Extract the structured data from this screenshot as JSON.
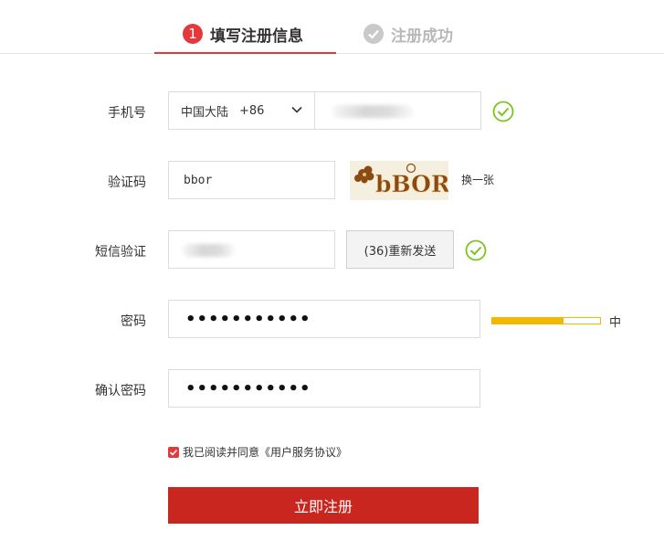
{
  "steps": {
    "step1_number": "1",
    "step1_label": "填写注册信息",
    "step2_label": "注册成功"
  },
  "form": {
    "phone": {
      "label": "手机号",
      "country": "中国大陆",
      "country_code": "+86"
    },
    "captcha": {
      "label": "验证码",
      "value": "bbor",
      "image_text": "bBOR",
      "refresh_label": "换一张"
    },
    "sms": {
      "label": "短信验证",
      "resend_button": "(36)重新发送"
    },
    "password": {
      "label": "密码",
      "masked_value": "•••••••••••",
      "strength_label": "中",
      "strength_level": 0.66
    },
    "confirm_password": {
      "label": "确认密码",
      "masked_value": "•••••••••••"
    },
    "agreement": {
      "text": "我已阅读并同意《用户服务协议》",
      "checked": true
    },
    "submit_label": "立即注册"
  },
  "colors": {
    "accent": "#e4393c",
    "submit": "#c9261f",
    "valid": "#7cc520",
    "strength": "#f5b800"
  },
  "icons": {
    "valid": "check-circle-icon",
    "dropdown": "chevron-down-icon",
    "step_done": "check-circle-icon"
  }
}
